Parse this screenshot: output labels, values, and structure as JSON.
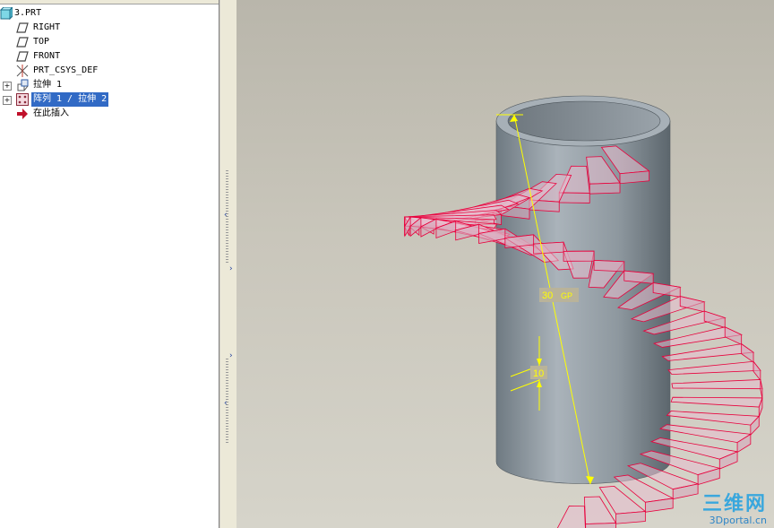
{
  "model_tree": {
    "root": {
      "label": "3.PRT",
      "icon": "part-icon"
    },
    "items": [
      {
        "label": "RIGHT",
        "icon": "datum-plane-icon"
      },
      {
        "label": "TOP",
        "icon": "datum-plane-icon"
      },
      {
        "label": "FRONT",
        "icon": "datum-plane-icon"
      },
      {
        "label": "PRT_CSYS_DEF",
        "icon": "coordinate-system-icon"
      },
      {
        "label": "拉伸 1",
        "icon": "extrude-icon"
      },
      {
        "label": "阵列 1 / 拉伸 2",
        "icon": "pattern-icon",
        "selected": true
      },
      {
        "label": "在此插入",
        "icon": "insert-here-arrow-icon"
      }
    ]
  },
  "viewport": {
    "dimension_height": "30",
    "dimension_height_unit": "GP",
    "dimension_step": "10",
    "colors": {
      "stairs_edge": "#e8003c",
      "dimension": "#ffff00",
      "cylinder": "#8f9aa2"
    }
  },
  "watermark": {
    "name": "三维网",
    "url": "3Dportal.cn"
  }
}
